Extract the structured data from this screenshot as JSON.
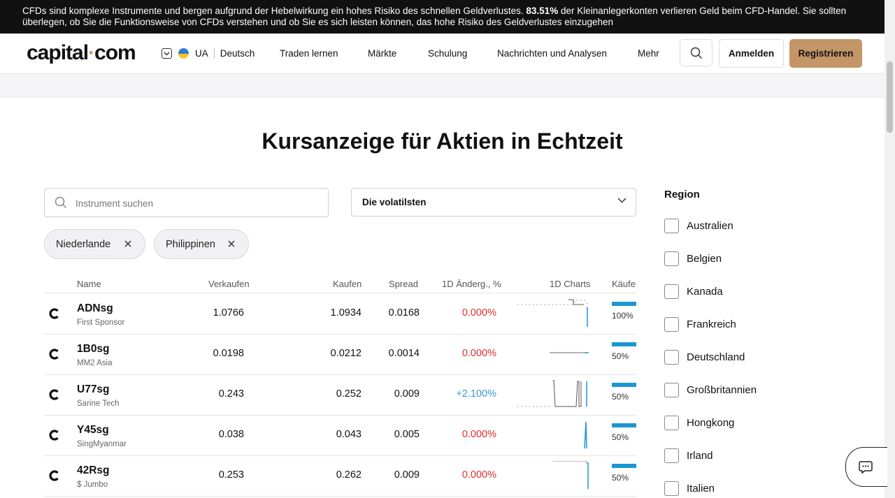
{
  "risk_banner": {
    "text_before": "CFDs sind komplexe Instrumente und bergen aufgrund der Hebelwirkung ein hohes Risiko des schnellen Geldverlustes.",
    "highlight": "83.51%",
    "text_after": "der Kleinanlegerkonten verlieren Geld beim CFD-Handel. Sie sollten überlegen, ob Sie die Funktionsweise von CFDs verstehen und ob Sie es sich leisten können, das hohe Risiko des Geldverlustes einzugehen"
  },
  "header": {
    "logo_left": "capital",
    "logo_dot": "·",
    "logo_right": "com",
    "country": "UA",
    "language": "Deutsch",
    "nav": [
      "Traden lernen",
      "Märkte",
      "Schulung",
      "Nachrichten und Analysen",
      "Mehr"
    ],
    "login_label": "Anmelden",
    "register_label": "Registrieren"
  },
  "page_title": "Kursanzeige für Aktien in Echtzeit",
  "search": {
    "placeholder": "Instrument suchen",
    "value": ""
  },
  "sort": {
    "selected": "Die volatilsten"
  },
  "chips": [
    "Niederlande",
    "Philippinen"
  ],
  "table": {
    "columns": [
      "Name",
      "Verkaufen",
      "Kaufen",
      "Spread",
      "1D Änderg., %",
      "1D Charts",
      "Käufer"
    ],
    "rows": [
      {
        "symbol": "ADNsg",
        "name": "First Sponsor",
        "sell": "1.0766",
        "buy": "1.0934",
        "spread": "0.0168",
        "change": "0.000%",
        "buyers_pct": "100%"
      },
      {
        "symbol": "1B0sg",
        "name": "MM2 Asia",
        "sell": "0.0198",
        "buy": "0.0212",
        "spread": "0.0014",
        "change": "0.000%",
        "buyers_pct": "50%"
      },
      {
        "symbol": "U77sg",
        "name": "Sarine Tech",
        "sell": "0.243",
        "buy": "0.252",
        "spread": "0.009",
        "change": "+2.100%",
        "buyers_pct": "50%"
      },
      {
        "symbol": "Y45sg",
        "name": "SingMyanmar",
        "sell": "0.038",
        "buy": "0.043",
        "spread": "0.005",
        "change": "0.000%",
        "buyers_pct": "50%"
      },
      {
        "symbol": "42Rsg",
        "name": "$ Jumbo",
        "sell": "0.253",
        "buy": "0.262",
        "spread": "0.009",
        "change": "0.000%",
        "buyers_pct": "50%"
      }
    ]
  },
  "region": {
    "title": "Region",
    "items": [
      "Australien",
      "Belgien",
      "Kanada",
      "Frankreich",
      "Deutschland",
      "Großbritannien",
      "Hongkong",
      "Irland",
      "Italien"
    ]
  },
  "colors": {
    "accent": "#c49567",
    "negative": "#e02d2d",
    "positive": "#3a98d6",
    "buyer_bar": "#1a97d2",
    "banner_bg": "#111111"
  },
  "icons": [
    "chevron-down-icon",
    "ukraine-flag-icon",
    "search-icon",
    "close-icon",
    "capital-logo-icon",
    "chat-icon"
  ]
}
